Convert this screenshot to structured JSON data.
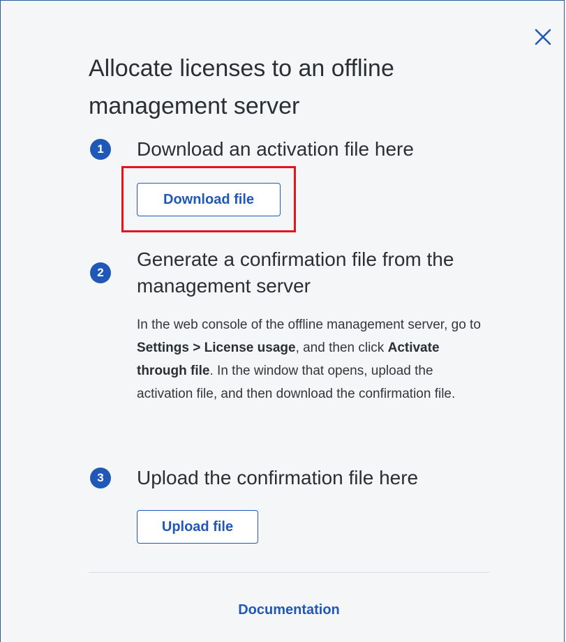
{
  "dialog": {
    "title": "Allocate licenses to an offline management server",
    "close_icon": "close-icon"
  },
  "steps": [
    {
      "number": "1",
      "title": "Download an activation file here",
      "button_label": "Download file"
    },
    {
      "number": "2",
      "title": "Generate a confirmation file from the management server",
      "description": {
        "part1": "In the web console of the offline management server, go to ",
        "bold1": "Settings > License usage",
        "part2": ", and then click ",
        "bold2": "Activate through file",
        "part3": ". In the window that opens, upload the activation file, and then download the confirmation file."
      }
    },
    {
      "number": "3",
      "title": "Upload the confirmation file here",
      "button_label": "Upload file"
    }
  ],
  "footer": {
    "link_label": "Documentation"
  },
  "colors": {
    "accent": "#2058b7",
    "highlight": "#e3141c",
    "border": "#2d5b9a"
  }
}
